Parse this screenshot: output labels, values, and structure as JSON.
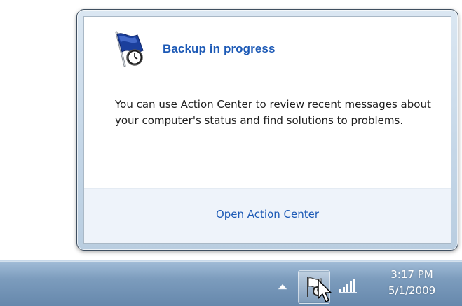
{
  "flyout": {
    "title": "Backup in progress",
    "message": "You can use Action Center to review recent messages about your computer's status and find solutions to problems.",
    "footer_link": "Open Action Center",
    "icon": "action-center-flag-clock-icon"
  },
  "taskbar": {
    "tray": {
      "show_hidden_icon": "tray-up-arrow-icon",
      "action_center_icon": "action-center-flag-clock-icon",
      "network_icon": "network-signal-icon"
    },
    "clock": {
      "time": "3:17 PM",
      "date": "5/1/2009"
    }
  },
  "colors": {
    "link": "#1d5ab6",
    "title": "#1d5ab6",
    "footer_bg": "#eef3fa",
    "taskbar": "#7c9cbd"
  }
}
